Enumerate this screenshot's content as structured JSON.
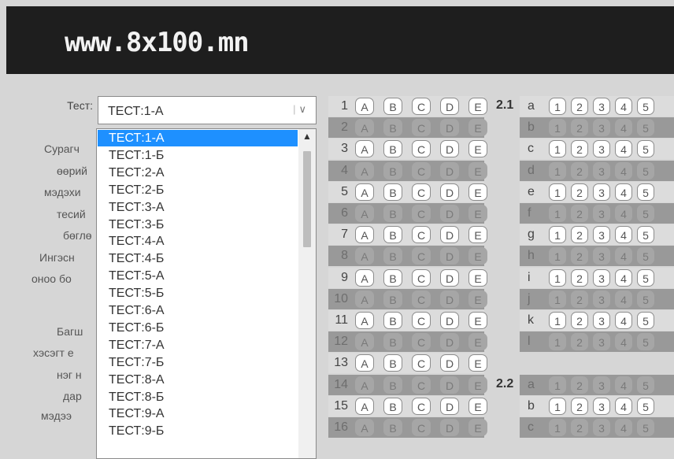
{
  "header": {
    "site_title": "www.8x100.mn"
  },
  "test_select": {
    "label": "Тест:",
    "value": "ТЕСТ:1-А",
    "arrow": "∨"
  },
  "dropdown_options": [
    "ТЕСТ:1-А",
    "ТЕСТ:1-Б",
    "ТЕСТ:2-А",
    "ТЕСТ:2-Б",
    "ТЕСТ:3-А",
    "ТЕСТ:3-Б",
    "ТЕСТ:4-А",
    "ТЕСТ:4-Б",
    "ТЕСТ:5-А",
    "ТЕСТ:5-Б",
    "ТЕСТ:6-А",
    "ТЕСТ:6-Б",
    "ТЕСТ:7-А",
    "ТЕСТ:7-Б",
    "ТЕСТ:8-А",
    "ТЕСТ:8-Б",
    "ТЕСТ:9-А",
    "ТЕСТ:9-Б"
  ],
  "selected_option_index": 0,
  "instructions_partial": [
    "Сурагч",
    "өөрий",
    "мэдэхи",
    "тесий",
    "бөглө",
    "Ингэсн",
    "оноо бо",
    "Багш",
    "хэсэгт е",
    "нэг н",
    "дар",
    "мэдээ"
  ],
  "answer_options": [
    "A",
    "B",
    "C",
    "D",
    "E"
  ],
  "part1_questions": [
    "1",
    "2",
    "3",
    "4",
    "5",
    "6",
    "7",
    "8",
    "9",
    "10",
    "11",
    "12",
    "13",
    "14",
    "15",
    "16"
  ],
  "section_2_1": {
    "label": "2.1",
    "items": [
      "a",
      "b",
      "c",
      "d",
      "e",
      "f",
      "g",
      "h",
      "i",
      "j",
      "k",
      "l"
    ]
  },
  "section_2_2": {
    "label": "2.2",
    "items": [
      "a",
      "b",
      "c"
    ]
  },
  "part2_options": [
    "1",
    "2",
    "3",
    "4",
    "5"
  ],
  "colors": {
    "header_bg": "#1e1e1e",
    "page_bg": "#d6d6d6",
    "selected_option": "#1e90ff",
    "row_light": "#dcdcdc",
    "row_dark": "#999999"
  }
}
